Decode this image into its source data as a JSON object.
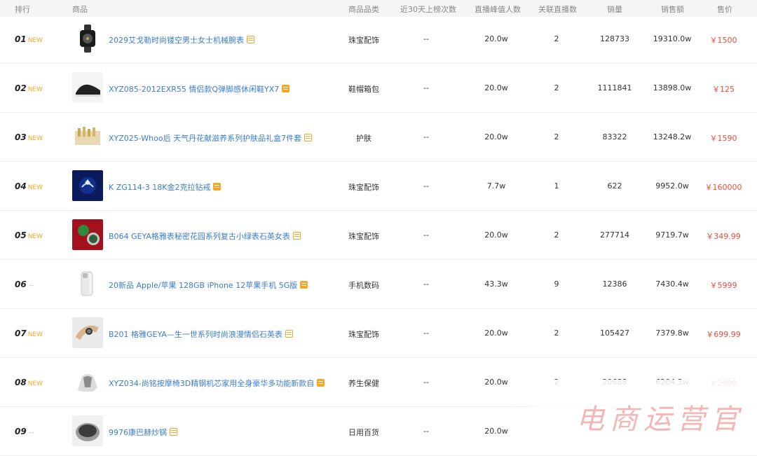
{
  "headers": {
    "rank": "排行",
    "product": "商品",
    "category": "商品品类",
    "listings30": "近30天上榜次数",
    "peak": "直播峰值人数",
    "linked": "关联直播数",
    "sales": "销量",
    "revenue": "销售额",
    "price": "售价"
  },
  "rows": [
    {
      "rank": "01",
      "badge": "NEW",
      "name": "2029艾戈勒时尚镂空男士女士机械腕表",
      "category": "珠宝配饰",
      "listings30": "--",
      "peak": "20.0w",
      "linked": "2",
      "sales": "128733",
      "revenue": "19310.0w",
      "price": "￥1500"
    },
    {
      "rank": "02",
      "badge": "NEW",
      "name": "XYZ085-2012EXR55 情侣款Q弹脚感休闲鞋YX7",
      "category": "鞋帽箱包",
      "listings30": "--",
      "peak": "20.0w",
      "linked": "2",
      "sales": "1111841",
      "revenue": "13898.0w",
      "price": "￥125"
    },
    {
      "rank": "03",
      "badge": "NEW",
      "name": "XYZ025-Whoo后 天气丹花献滋养系列护肤品礼盒7件套",
      "category": "护肤",
      "listings30": "--",
      "peak": "20.0w",
      "linked": "2",
      "sales": "83322",
      "revenue": "13248.2w",
      "price": "￥1590"
    },
    {
      "rank": "04",
      "badge": "NEW",
      "name": "K ZG114-3 18K金2克拉钻戒",
      "category": "珠宝配饰",
      "listings30": "--",
      "peak": "7.7w",
      "linked": "1",
      "sales": "622",
      "revenue": "9952.0w",
      "price": "￥160000"
    },
    {
      "rank": "05",
      "badge": "NEW",
      "name": "B064 GEYA格雅表秘密花园系列复古小绿表石英女表",
      "category": "珠宝配饰",
      "listings30": "--",
      "peak": "20.0w",
      "linked": "2",
      "sales": "277714",
      "revenue": "9719.7w",
      "price": "￥349.99"
    },
    {
      "rank": "06",
      "badge": "--",
      "name": "20新品 Apple/苹果 128GB iPhone 12苹果手机 5G版",
      "category": "手机数码",
      "listings30": "--",
      "peak": "43.3w",
      "linked": "9",
      "sales": "12386",
      "revenue": "7430.4w",
      "price": "￥5999"
    },
    {
      "rank": "07",
      "badge": "NEW",
      "name": "B201 格雅GEYA—生一世系列时尚浪漫情侣石英表",
      "category": "珠宝配饰",
      "listings30": "--",
      "peak": "20.0w",
      "linked": "2",
      "sales": "105427",
      "revenue": "7379.8w",
      "price": "￥699.99"
    },
    {
      "rank": "08",
      "badge": "NEW",
      "name": "XYZ034-尚铭按摩椅3D精钢机芯家用全身豪华多功能新款自",
      "category": "养生保健",
      "listings30": "--",
      "peak": "20.0w",
      "linked": "2",
      "sales": "20688",
      "revenue": "6204.3w",
      "price": "￥2999"
    },
    {
      "rank": "09",
      "badge": "--",
      "name": "9976康巴赫炒锅",
      "category": "日用百货",
      "listings30": "--",
      "peak": "20.0w",
      "linked": "",
      "sales": "",
      "revenue": "",
      "price": ""
    }
  ],
  "watermark": "电商运营官",
  "colors": {
    "link": "#3a7ccc",
    "price": "#f04b3a",
    "badge": "#f5a623"
  }
}
